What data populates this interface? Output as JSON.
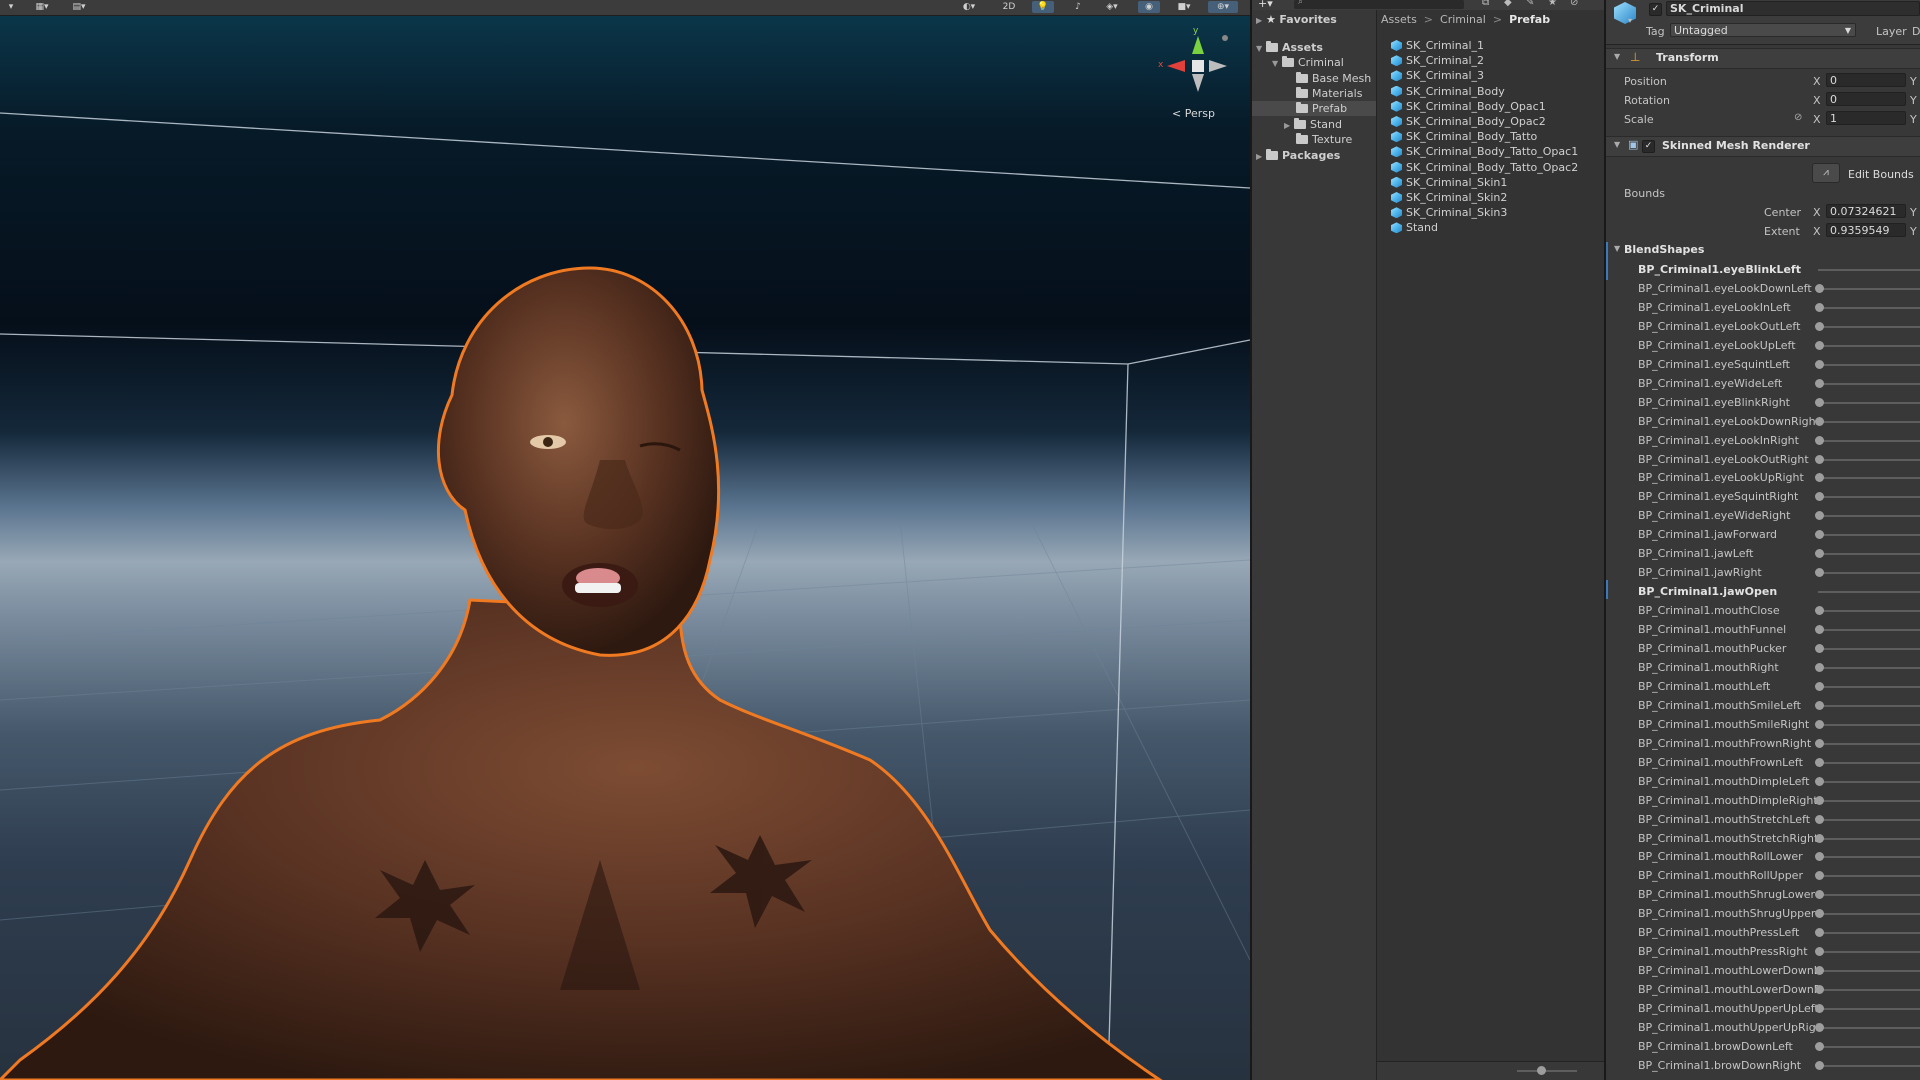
{
  "scene": {
    "toolbar": {
      "mode_2d": "2D"
    },
    "gizmo": {
      "y": "y",
      "x": "x",
      "persp": "Persp"
    }
  },
  "project": {
    "favorites": "Favorites",
    "assets": "Assets",
    "folders": [
      "Criminal",
      "Base Mesh",
      "Materials",
      "Prefab",
      "Stand",
      "Texture"
    ],
    "packages": "Packages",
    "breadcrumb": {
      "a": "Assets",
      "b": "Criminal",
      "c": "Prefab"
    },
    "files": [
      "SK_Criminal_1",
      "SK_Criminal_2",
      "SK_Criminal_3",
      "SK_Criminal_Body",
      "SK_Criminal_Body_Opac1",
      "SK_Criminal_Body_Opac2",
      "SK_Criminal_Body_Tatto",
      "SK_Criminal_Body_Tatto_Opac1",
      "SK_Criminal_Body_Tatto_Opac2",
      "SK_Criminal_Skin1",
      "SK_Criminal_Skin2",
      "SK_Criminal_Skin3",
      "Stand"
    ]
  },
  "inspector": {
    "object_name": "SK_Criminal",
    "tag_label": "Tag",
    "tag_value": "Untagged",
    "layer_label": "Layer",
    "layer_value": "D",
    "transform": {
      "title": "Transform",
      "position_label": "Position",
      "rotation_label": "Rotation",
      "scale_label": "Scale",
      "axis_x": "X",
      "axis_y": "Y",
      "position_x": "0",
      "rotation_x": "0",
      "scale_x": "1"
    },
    "smr": {
      "title": "Skinned Mesh Renderer",
      "edit_bounds": "Edit Bounds",
      "bounds_label": "Bounds",
      "center_label": "Center",
      "extent_label": "Extent",
      "center_x": "0.07324621",
      "extent_x": "0.9359549"
    },
    "blendshapes_title": "BlendShapes",
    "blendshapes": [
      "BP_Criminal1.eyeBlinkLeft",
      "BP_Criminal1.eyeLookDownLeft",
      "BP_Criminal1.eyeLookInLeft",
      "BP_Criminal1.eyeLookOutLeft",
      "BP_Criminal1.eyeLookUpLeft",
      "BP_Criminal1.eyeSquintLeft",
      "BP_Criminal1.eyeWideLeft",
      "BP_Criminal1.eyeBlinkRight",
      "BP_Criminal1.eyeLookDownRigh",
      "BP_Criminal1.eyeLookInRight",
      "BP_Criminal1.eyeLookOutRight",
      "BP_Criminal1.eyeLookUpRight",
      "BP_Criminal1.eyeSquintRight",
      "BP_Criminal1.eyeWideRight",
      "BP_Criminal1.jawForward",
      "BP_Criminal1.jawLeft",
      "BP_Criminal1.jawRight",
      "BP_Criminal1.jawOpen",
      "BP_Criminal1.mouthClose",
      "BP_Criminal1.mouthFunnel",
      "BP_Criminal1.mouthPucker",
      "BP_Criminal1.mouthRight",
      "BP_Criminal1.mouthLeft",
      "BP_Criminal1.mouthSmileLeft",
      "BP_Criminal1.mouthSmileRight",
      "BP_Criminal1.mouthFrownRight",
      "BP_Criminal1.mouthFrownLeft",
      "BP_Criminal1.mouthDimpleLeft",
      "BP_Criminal1.mouthDimpleRight",
      "BP_Criminal1.mouthStretchLeft",
      "BP_Criminal1.mouthStretchRight",
      "BP_Criminal1.mouthRollLower",
      "BP_Criminal1.mouthRollUpper",
      "BP_Criminal1.mouthShrugLower",
      "BP_Criminal1.mouthShrugUpper",
      "BP_Criminal1.mouthPressLeft",
      "BP_Criminal1.mouthPressRight",
      "BP_Criminal1.mouthLowerDownL",
      "BP_Criminal1.mouthLowerDownF",
      "BP_Criminal1.mouthUpperUpLeft",
      "BP_Criminal1.mouthUpperUpRigt",
      "BP_Criminal1.browDownLeft",
      "BP_Criminal1.browDownRight"
    ],
    "bold_blendshapes": [
      0,
      17
    ]
  }
}
